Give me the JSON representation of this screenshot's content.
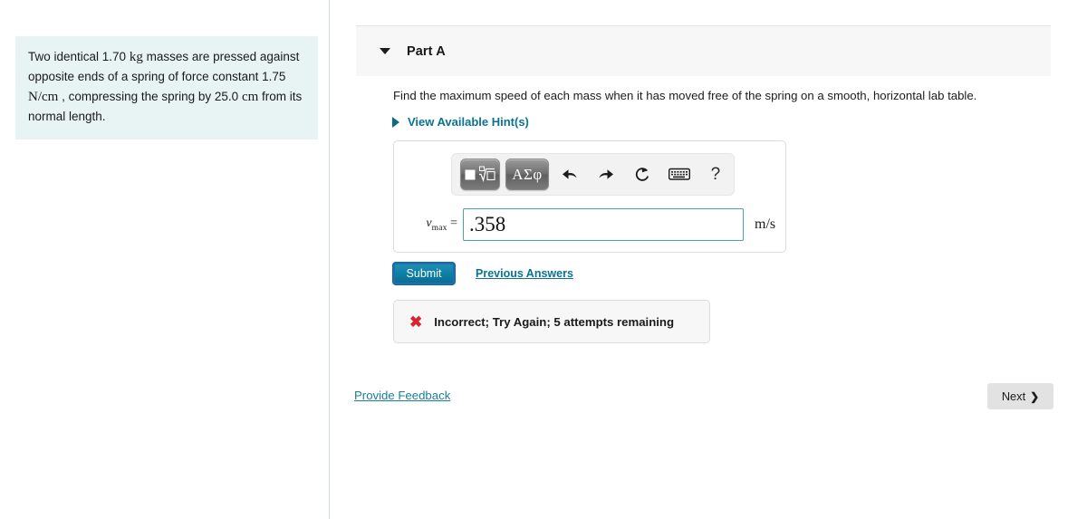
{
  "problem": {
    "segments": [
      {
        "text": "Two identical 1.70 ",
        "style": "plain"
      },
      {
        "text": "kg",
        "style": "math"
      },
      {
        "text": " masses are pressed against opposite ends of a spring of force constant 1.75 ",
        "style": "plain"
      },
      {
        "text": "N/cm",
        "style": "math"
      },
      {
        "text": " , compressing the spring by 25.0 ",
        "style": "plain"
      },
      {
        "text": "cm",
        "style": "math"
      },
      {
        "text": " from its normal length.",
        "style": "plain"
      }
    ],
    "full_text": "Two identical 1.70 kg masses are pressed against opposite ends of a spring of force constant 1.75 N/cm , compressing the spring by 25.0 cm from its normal length."
  },
  "part": {
    "title": "Part A",
    "collapse_icon": "caret-down-icon",
    "question": "Find the maximum speed of each mass when it has moved free of the spring on a smooth, horizontal lab table.",
    "hint_link": "View Available Hint(s)",
    "hint_icon": "caret-right-icon"
  },
  "answer": {
    "toolbar": {
      "template_button_label": "■√□",
      "greek_button_label": "ΑΣφ",
      "undo_icon": "undo-icon",
      "redo_icon": "redo-icon",
      "reset_icon": "reset-icon",
      "keyboard_icon": "keyboard-icon",
      "help_icon": "?"
    },
    "variable": "v",
    "variable_subscript": "max",
    "equals": " = ",
    "value": ".358",
    "placeholder": "",
    "unit": "m/s"
  },
  "actions": {
    "submit_label": "Submit",
    "previous_answers_label": "Previous Answers"
  },
  "feedback": {
    "icon": "x-mark-icon",
    "message": "Incorrect; Try Again; 5 attempts remaining"
  },
  "footer": {
    "provide_feedback_label": "Provide Feedback",
    "next_label": "Next",
    "next_chevron": "❯"
  },
  "colors": {
    "problem_bg": "#e8f4f4",
    "link_teal": "#0b7391",
    "submit_blue": "#0d7fa4",
    "error_red": "#d8242f",
    "header_gray": "#f7f7f7",
    "input_border": "#4d9cb8"
  }
}
